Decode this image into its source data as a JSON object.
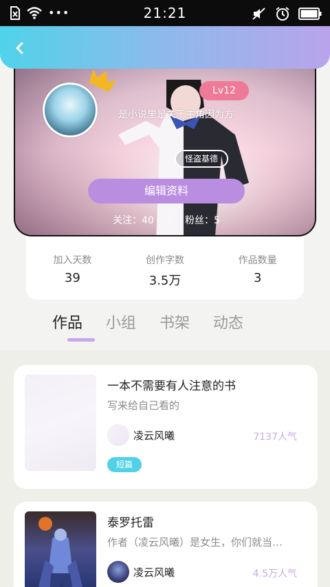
{
  "status_bar": {
    "time": "21:21"
  },
  "header": {
    "back_icon": "chevron-left-icon"
  },
  "profile": {
    "level": "Lv12",
    "bio": "是小说里是关于主角因为方",
    "title_tag": "怪盗基德",
    "edit_button": "编辑资料",
    "following_label": "关注：40",
    "followers_label": "粉丝：5"
  },
  "stats": [
    {
      "label": "加入天数",
      "value": "39"
    },
    {
      "label": "创作字数",
      "value": "3.5万"
    },
    {
      "label": "作品数量",
      "value": "3"
    }
  ],
  "tabs": [
    {
      "label": "作品",
      "active": true
    },
    {
      "label": "小组",
      "active": false
    },
    {
      "label": "书架",
      "active": false
    },
    {
      "label": "动态",
      "active": false
    }
  ],
  "works": [
    {
      "title": "一本不需要有人注意的书",
      "description": "写来给自己看的",
      "author": "凌云风曦",
      "popularity": "7137人气",
      "tag": "短篇"
    },
    {
      "title": "泰罗托雷",
      "description": "作者（凌云风曦）是女生，你们就当…",
      "author": "凌云风曦",
      "popularity": "4.5万人气",
      "tag": ""
    }
  ],
  "colors": {
    "accent_purple": "#b98de0",
    "level_pink": "#ee7a98",
    "tag_cyan": "#52d1e6"
  }
}
